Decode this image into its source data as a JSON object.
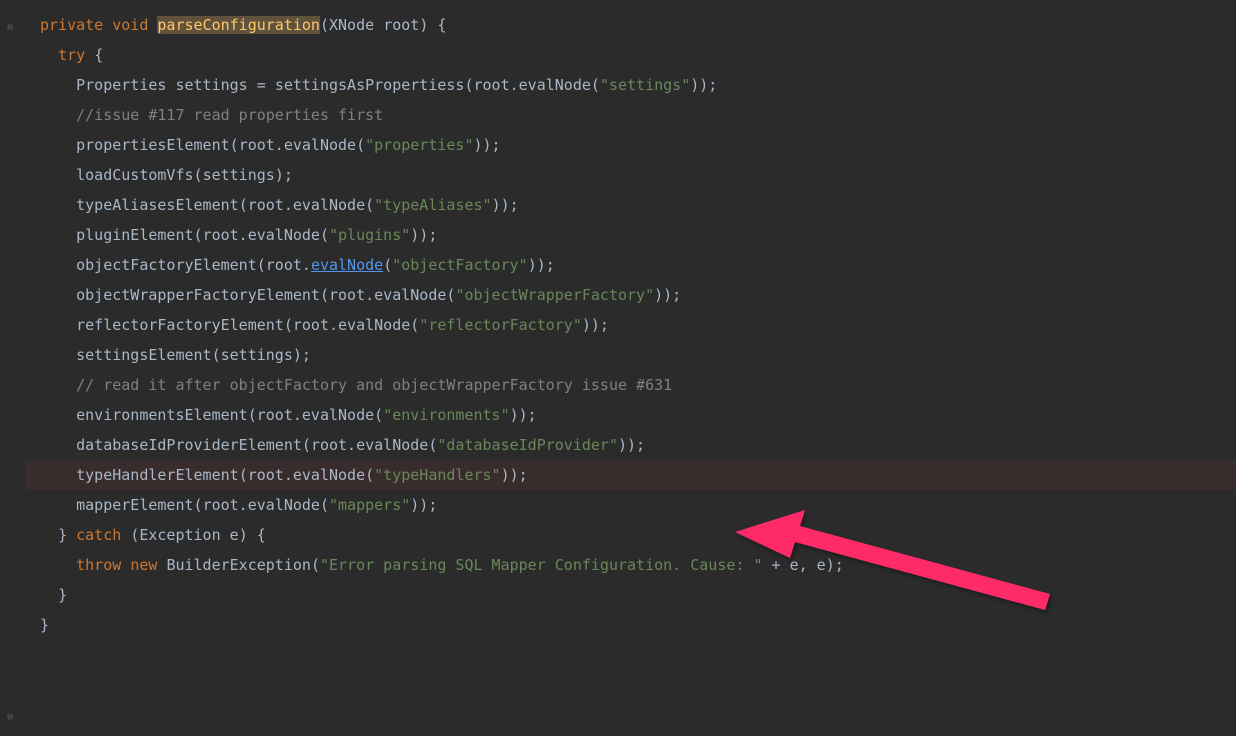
{
  "method": {
    "modifiers": "private void",
    "name": "parseConfiguration",
    "paramType": "XNode",
    "paramName": "root"
  },
  "lines": {
    "try": "try",
    "settings_decl_type": "Properties",
    "settings_decl_name": "settings",
    "settings_call": "settingsAsPropertiess",
    "root_eval": "root.",
    "evalNode": "evalNode",
    "str_settings": "\"settings\"",
    "comment_117": "//issue #117 read properties first",
    "propertiesElement": "propertiesElement",
    "str_properties": "\"properties\"",
    "loadCustomVfs": "loadCustomVfs",
    "settings_arg": "settings",
    "typeAliasesElement": "typeAliasesElement",
    "str_typeAliases": "\"typeAliases\"",
    "pluginElement": "pluginElement",
    "str_plugins": "\"plugins\"",
    "objectFactoryElement": "objectFactoryElement",
    "str_objectFactory": "\"objectFactory\"",
    "objectWrapperFactoryElement": "objectWrapperFactoryElement",
    "str_objectWrapperFactory": "\"objectWrapperFactory\"",
    "reflectorFactoryElement": "reflectorFactoryElement",
    "str_reflectorFactory": "\"reflectorFactory\"",
    "settingsElement": "settingsElement",
    "comment_631": "// read it after objectFactory and objectWrapperFactory issue #631",
    "environmentsElement": "environmentsElement",
    "str_environments": "\"environments\"",
    "databaseIdProviderElement": "databaseIdProviderElement",
    "str_databaseIdProvider": "\"databaseIdProvider\"",
    "typeHandlerElement": "typeHandlerElement",
    "str_typeHandlers": "\"typeHandlers\"",
    "mapperElement": "mapperElement",
    "str_mappers": "\"mappers\"",
    "catch": "catch",
    "exception_type": "Exception",
    "exception_name": "e",
    "throw": "throw",
    "new": "new",
    "BuilderException": "BuilderException",
    "error_string": "\"Error parsing SQL Mapper Configuration. Cause: \"",
    "plus_e": " + e, e);"
  }
}
